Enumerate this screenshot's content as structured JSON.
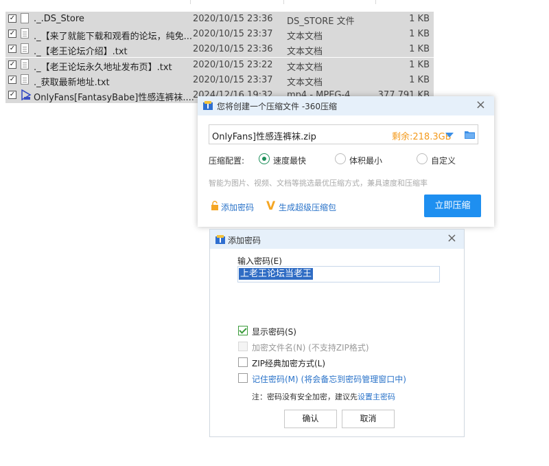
{
  "files": [
    {
      "name": "._.DS_Store",
      "date": "2020/10/15 23:36",
      "type": "DS_STORE 文件",
      "size": "1 KB",
      "icon": "blank-file-icon"
    },
    {
      "name": "._【来了就能下载和观看的论坛，纯免...",
      "date": "2020/10/15 23:37",
      "type": "文本文档",
      "size": "1 KB",
      "icon": "text-file-icon"
    },
    {
      "name": "._【老王论坛介绍】.txt",
      "date": "2020/10/15 23:36",
      "type": "文本文档",
      "size": "1 KB",
      "icon": "text-file-icon"
    },
    {
      "name": "._【老王论坛永久地址发布页】.txt",
      "date": "2020/10/15 23:22",
      "type": "文本文档",
      "size": "1 KB",
      "icon": "text-file-icon"
    },
    {
      "name": "._获取最新地址.txt",
      "date": "2020/10/15 23:37",
      "type": "文本文档",
      "size": "1 KB",
      "icon": "text-file-icon"
    },
    {
      "name": "OnlyFans[FantasyBabe]性感连裤袜....",
      "date": "2024/12/16 19:32",
      "type": "mp4 - MPEG-4",
      "size": "377,791 KB",
      "icon": "video-file-icon"
    }
  ],
  "compress_dialog": {
    "title": "您将创建一个压缩文件 -360压缩",
    "filename": "OnlyFans]性感连裤袜.zip",
    "free_space": "剩余:218.3GB",
    "config_label": "压缩配置:",
    "options": [
      "速度最快",
      "体积最小",
      "自定义"
    ],
    "selected_option": "速度最快",
    "hint": "智能为图片、视频、文档等挑选最优压缩方式，兼具速度和压缩率",
    "add_password": "添加密码",
    "super_package": "生成超级压缩包",
    "compress_now": "立即压缩",
    "accent_color": "#1e8ff0",
    "free_space_color": "#f39a1d"
  },
  "password_dialog": {
    "title": "添加密码",
    "input_label": "输入密码(E)",
    "password_value": "上老王论坛当老王",
    "show_password": "显示密码(S)",
    "encrypt_filenames": "加密文件名(N) (不支持ZIP格式)",
    "zip_classic": "ZIP经典加密方式(L)",
    "remember_password": "记住密码(M) (将会备忘到密码管理窗口中)",
    "note_prefix": "注：密码没有安全加密，建议先",
    "note_link": "设置主密码",
    "ok": "确认",
    "cancel": "取消"
  }
}
